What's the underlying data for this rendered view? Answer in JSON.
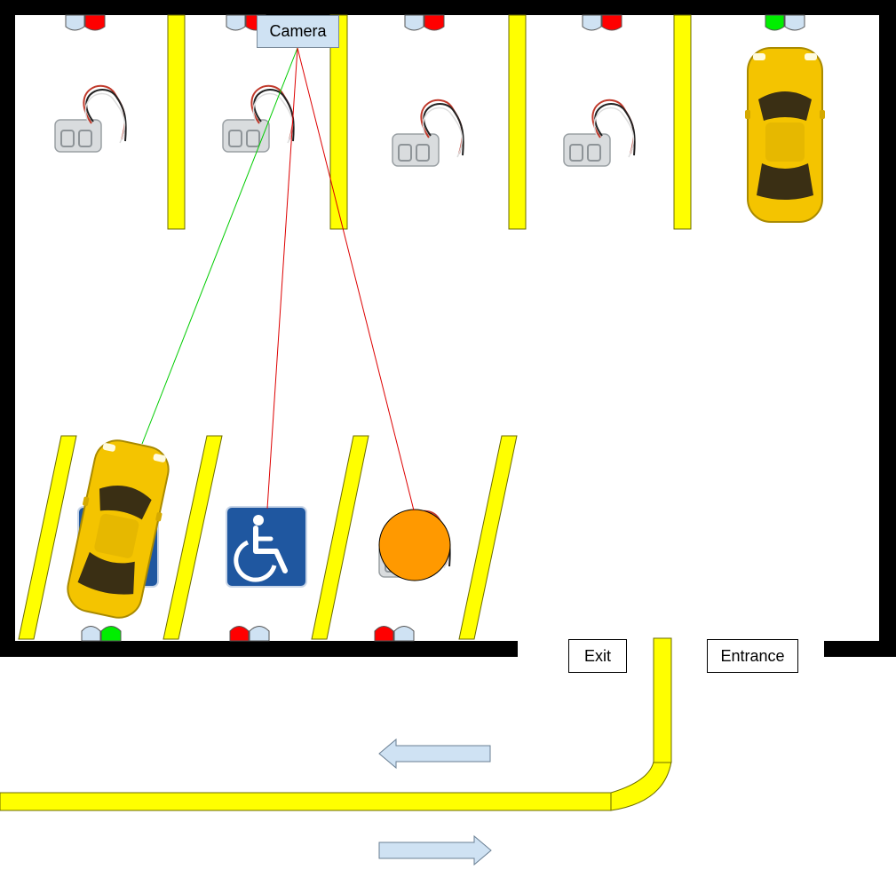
{
  "labels": {
    "camera": "Camera",
    "exit": "Exit",
    "entrance": "Entrance"
  },
  "colors": {
    "wall": "#000000",
    "lane_line": "#ffff00",
    "lane_line_border": "#6b6b00",
    "indicator_red": "#ff0000",
    "indicator_green": "#00ee00",
    "indicator_off": "#cfe2f3",
    "camera_box": "#cfe2f3",
    "sight_line_free": "#00cc00",
    "sight_line_occupied": "#dd0000",
    "obstacle": "#ff9900",
    "arrow_fill": "#cfe2f3",
    "car_body": "#f4c400",
    "accessible_sign": "#1f57a0"
  },
  "icons": [
    "load-cell-sensor-icon",
    "yellow-car-icon",
    "accessible-parking-sign-icon",
    "left-arrow-icon",
    "right-arrow-icon"
  ],
  "top_row_spots": [
    {
      "id": "top-1",
      "content": "sensor",
      "indicator": [
        "off",
        "red"
      ]
    },
    {
      "id": "top-2",
      "content": "sensor",
      "indicator": [
        "off",
        "red"
      ]
    },
    {
      "id": "top-3",
      "content": "sensor",
      "indicator": [
        "off",
        "red"
      ]
    },
    {
      "id": "top-4",
      "content": "sensor",
      "indicator": [
        "off",
        "red"
      ]
    },
    {
      "id": "top-5",
      "content": "car",
      "indicator": [
        "green",
        "off"
      ]
    }
  ],
  "bottom_row_spots": [
    {
      "id": "bottom-1",
      "content": "car",
      "indicator": [
        "off",
        "green"
      ],
      "sight_line": "free"
    },
    {
      "id": "bottom-2",
      "content": "accessible-sign",
      "indicator": [
        "red",
        "off"
      ],
      "sight_line": "occupied"
    },
    {
      "id": "bottom-3",
      "content": "obstacle",
      "indicator": [
        "red",
        "off"
      ],
      "sight_line": "occupied"
    }
  ]
}
